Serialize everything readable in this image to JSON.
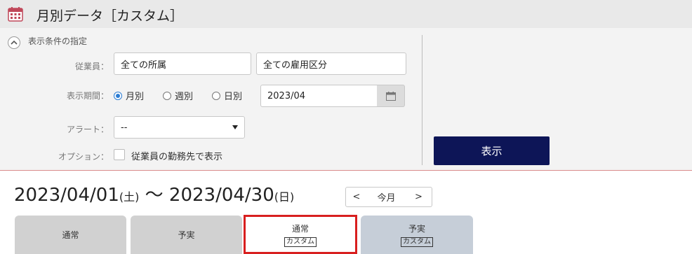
{
  "header": {
    "title": "月別データ［カスタム］"
  },
  "conditions": {
    "title": "表示条件の指定",
    "employee_label": "従業員：",
    "department_value": "全ての所属",
    "employment_value": "全ての雇用区分",
    "period_label": "表示期間：",
    "period_options": [
      "月別",
      "週別",
      "日別"
    ],
    "period_selected": "月別",
    "date_value": "2023/04",
    "alert_label": "アラート：",
    "alert_value": "--",
    "option_label": "オプション：",
    "option_checkbox_label": "従業員の勤務先で表示",
    "option_checked": false,
    "show_button": "表示"
  },
  "range": {
    "start": "2023/04/01",
    "start_dow": "(土)",
    "separator": "〜",
    "end": "2023/04/30",
    "end_dow": "(日)",
    "prev": "<",
    "current": "今月",
    "next": ">"
  },
  "tabs": [
    {
      "label": "通常",
      "sub": ""
    },
    {
      "label": "予実",
      "sub": ""
    },
    {
      "label": "通常",
      "sub": "カスタム",
      "active": true
    },
    {
      "label": "予実",
      "sub": "カスタム"
    }
  ],
  "colors": {
    "primary_button": "#0d1557",
    "active_tab_border": "#d81f1f",
    "radio_selected": "#2b7cd3"
  }
}
